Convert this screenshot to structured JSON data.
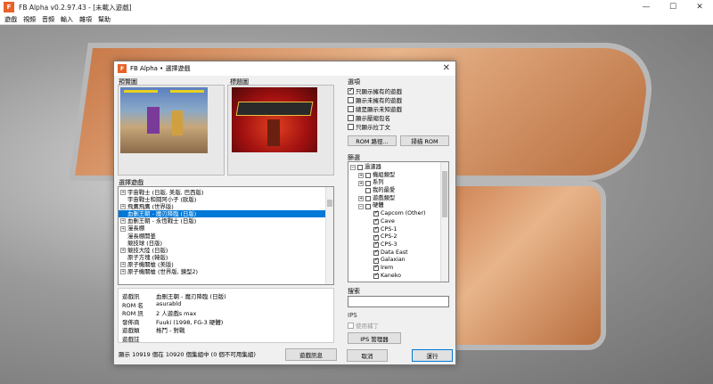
{
  "window": {
    "title": "FB Alpha v0.2.97.43 - [未載入遊戲]",
    "icon": "fba-app-icon"
  },
  "menu": [
    "遊戲",
    "視頻",
    "音頻",
    "輸入",
    "雜項",
    "幫助"
  ],
  "dialog": {
    "title": "FB Alpha • 選擇遊戲",
    "preview_label": "預覽圖",
    "title_label": "標題圖",
    "list_label": "選擇遊戲",
    "games": [
      {
        "name": "宇宙戰士 (日版, 美版, 巴西版)",
        "exp": true
      },
      {
        "name": "宇宙戰士和鬪阿小子 (歐版)",
        "exp": false
      },
      {
        "name": "飛鷹飛鷹 (世界版)",
        "exp": true
      },
      {
        "name": "血刪王朝 - 魔刃降臨 (日版)",
        "exp": false,
        "selected": true
      },
      {
        "name": "血刪王朝 - 永恆戰士 (日版)",
        "exp": true
      },
      {
        "name": "漫長棚",
        "exp": true
      },
      {
        "name": "漫長棚開釜",
        "exp": false
      },
      {
        "name": "競技球 (日版)",
        "exp": false
      },
      {
        "name": "競技大陸 (日版)",
        "exp": true
      },
      {
        "name": "原子方塊 (韓版)",
        "exp": false
      },
      {
        "name": "原子機關槍 (美版)",
        "exp": true
      },
      {
        "name": "原子機關槍 (世界版, 鏡型2)",
        "exp": true
      }
    ],
    "info": [
      {
        "key": "遊戲訊",
        "value": "血刪王朝 - 魔刃降臨 (日版)"
      },
      {
        "key": "ROM 名",
        "value": "asurabld"
      },
      {
        "key": "ROM 訊",
        "value": "2 人遊戲s max"
      },
      {
        "key": "發佈商",
        "value": "Fuuki (1998, FG-3 硬體)"
      },
      {
        "key": "遊戲類",
        "value": "格鬥 - 對戰"
      },
      {
        "key": "遊戲註",
        "value": ""
      }
    ],
    "status": "顯示 10919 個在 10920 個集組中 (0 個不可用集組)",
    "info_button": "遊戲訊息",
    "options_label": "選項",
    "options": [
      {
        "label": "只顯示擁有的遊戲",
        "checked": true
      },
      {
        "label": "顯示未擁有的遊戲",
        "checked": false
      },
      {
        "label": "總是顯示未知遊戲",
        "checked": false
      },
      {
        "label": "顯示壓縮包名",
        "checked": false
      },
      {
        "label": "只顯示拉丁文",
        "checked": false
      }
    ],
    "rom_path_button": "ROM 路徑...",
    "scan_rom_button": "掃描 ROM",
    "filter_label": "篩選",
    "filters": [
      {
        "label": "過濾器",
        "level": 0,
        "exp": "−",
        "checked": false
      },
      {
        "label": "機組類型",
        "level": 1,
        "exp": "+",
        "checked": false
      },
      {
        "label": "系列",
        "level": 1,
        "exp": "+",
        "checked": false
      },
      {
        "label": "我的最愛",
        "level": 1,
        "exp": "",
        "checked": false
      },
      {
        "label": "遊戲類型",
        "level": 1,
        "exp": "+",
        "checked": false
      },
      {
        "label": "硬體",
        "level": 1,
        "exp": "−",
        "checked": false
      },
      {
        "label": "Capcom (Other)",
        "level": 2,
        "exp": "",
        "checked": true
      },
      {
        "label": "Cave",
        "level": 2,
        "exp": "",
        "checked": true
      },
      {
        "label": "CPS-1",
        "level": 2,
        "exp": "",
        "checked": true
      },
      {
        "label": "CPS-2",
        "level": 2,
        "exp": "",
        "checked": true
      },
      {
        "label": "CPS-3",
        "level": 2,
        "exp": "",
        "checked": true
      },
      {
        "label": "Data East",
        "level": 2,
        "exp": "",
        "checked": true
      },
      {
        "label": "Galaxian",
        "level": 2,
        "exp": "",
        "checked": true
      },
      {
        "label": "Irem",
        "level": 2,
        "exp": "",
        "checked": true
      },
      {
        "label": "Kaneko",
        "level": 2,
        "exp": "",
        "checked": true
      }
    ],
    "search_label": "搜索",
    "search_value": "",
    "ips_label": "IPS",
    "use_patch_label": "使用補丁",
    "ips_manager_button": "IPS 管理器",
    "cancel_button": "取消",
    "run_button": "運行"
  }
}
